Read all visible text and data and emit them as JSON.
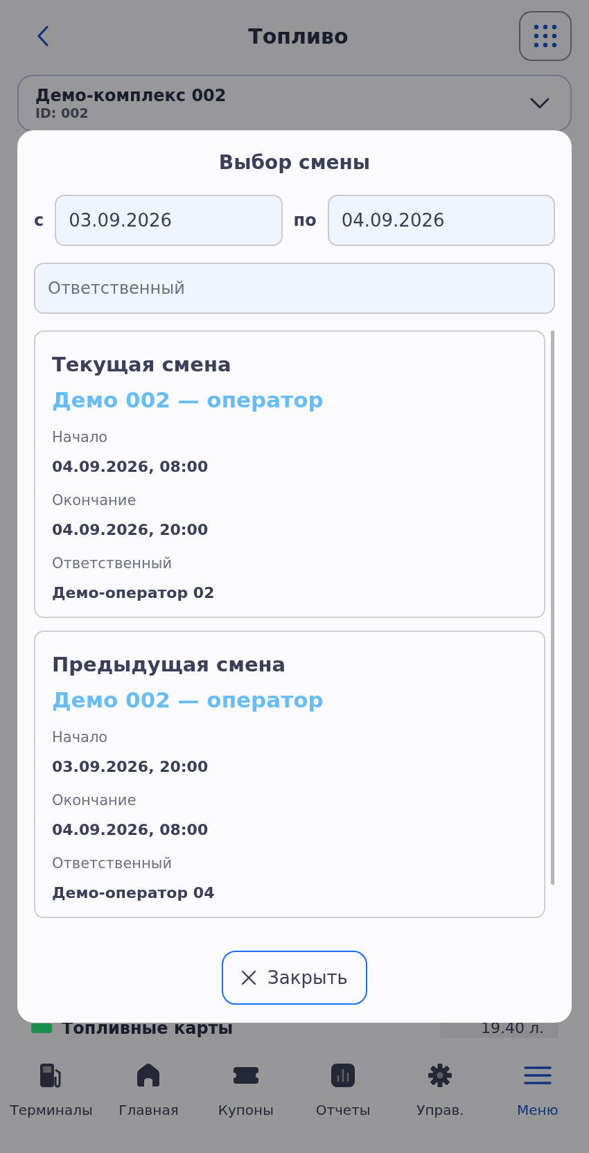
{
  "header": {
    "title": "Топливо"
  },
  "complex": {
    "name": "Демо-комплекс 002",
    "id": "ID: 002"
  },
  "background_row": {
    "label": "Топливные карты",
    "value": "19.40 л.",
    "color": "#1a9050"
  },
  "modal": {
    "title": "Выбор смены",
    "from_label": "с",
    "from_value": "03.09.2026",
    "to_label": "по",
    "to_value": "04.09.2026",
    "responsible_placeholder": "Ответственный",
    "shifts": [
      {
        "title": "Текущая смена",
        "name": "Демо 002 — оператор",
        "fields": [
          {
            "label": "Начало",
            "value": "04.09.2026, 08:00"
          },
          {
            "label": "Окончание",
            "value": "04.09.2026, 20:00"
          },
          {
            "label": "Ответственный",
            "value": "Демо-оператор 02"
          }
        ]
      },
      {
        "title": "Предыдущая смена",
        "name": "Демо 002 — оператор",
        "fields": [
          {
            "label": "Начало",
            "value": "03.09.2026, 20:00"
          },
          {
            "label": "Окончание",
            "value": "04.09.2026, 08:00"
          },
          {
            "label": "Ответственный",
            "value": "Демо-оператор 04"
          }
        ]
      }
    ],
    "close_label": "Закрыть"
  },
  "nav": [
    {
      "label": "Терминалы",
      "selected": false
    },
    {
      "label": "Главная",
      "selected": false
    },
    {
      "label": "Купоны",
      "selected": false
    },
    {
      "label": "Отчеты",
      "selected": false
    },
    {
      "label": "Управ.",
      "selected": false
    },
    {
      "label": "Меню",
      "selected": true
    }
  ]
}
